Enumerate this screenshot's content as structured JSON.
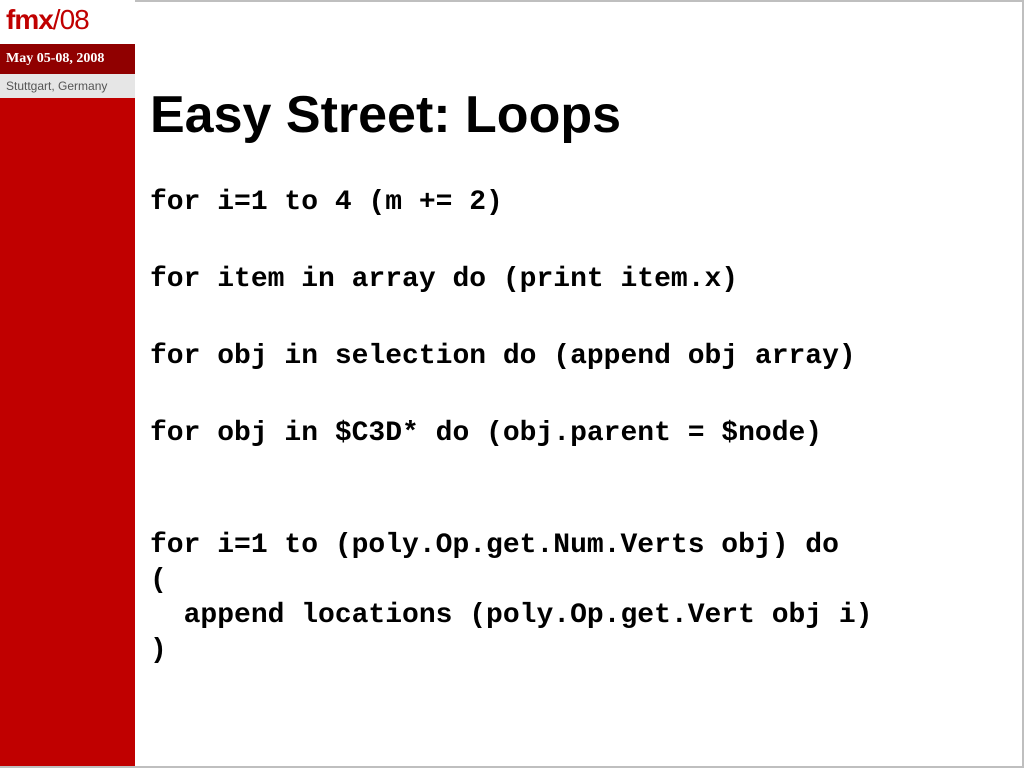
{
  "sidebar": {
    "logo_prefix": "fmx",
    "logo_slash_year": "/08",
    "date_line": "May 05-08, 2008",
    "location": "Stuttgart, Germany"
  },
  "slide": {
    "title": "Easy Street: Loops",
    "code_lines": {
      "l1": "for i=1 to 4 (m += 2)",
      "l2": "for item in array do (print item.x)",
      "l3": "for obj in selection do (append obj array)",
      "l4": "for obj in $C3D* do (obj.parent = $node)",
      "l5a": "for i=1 to (poly.Op.get.Num.Verts obj) do",
      "l5b": "(",
      "l5c": "  append locations (poly.Op.get.Vert obj i)",
      "l5d": ")"
    }
  }
}
